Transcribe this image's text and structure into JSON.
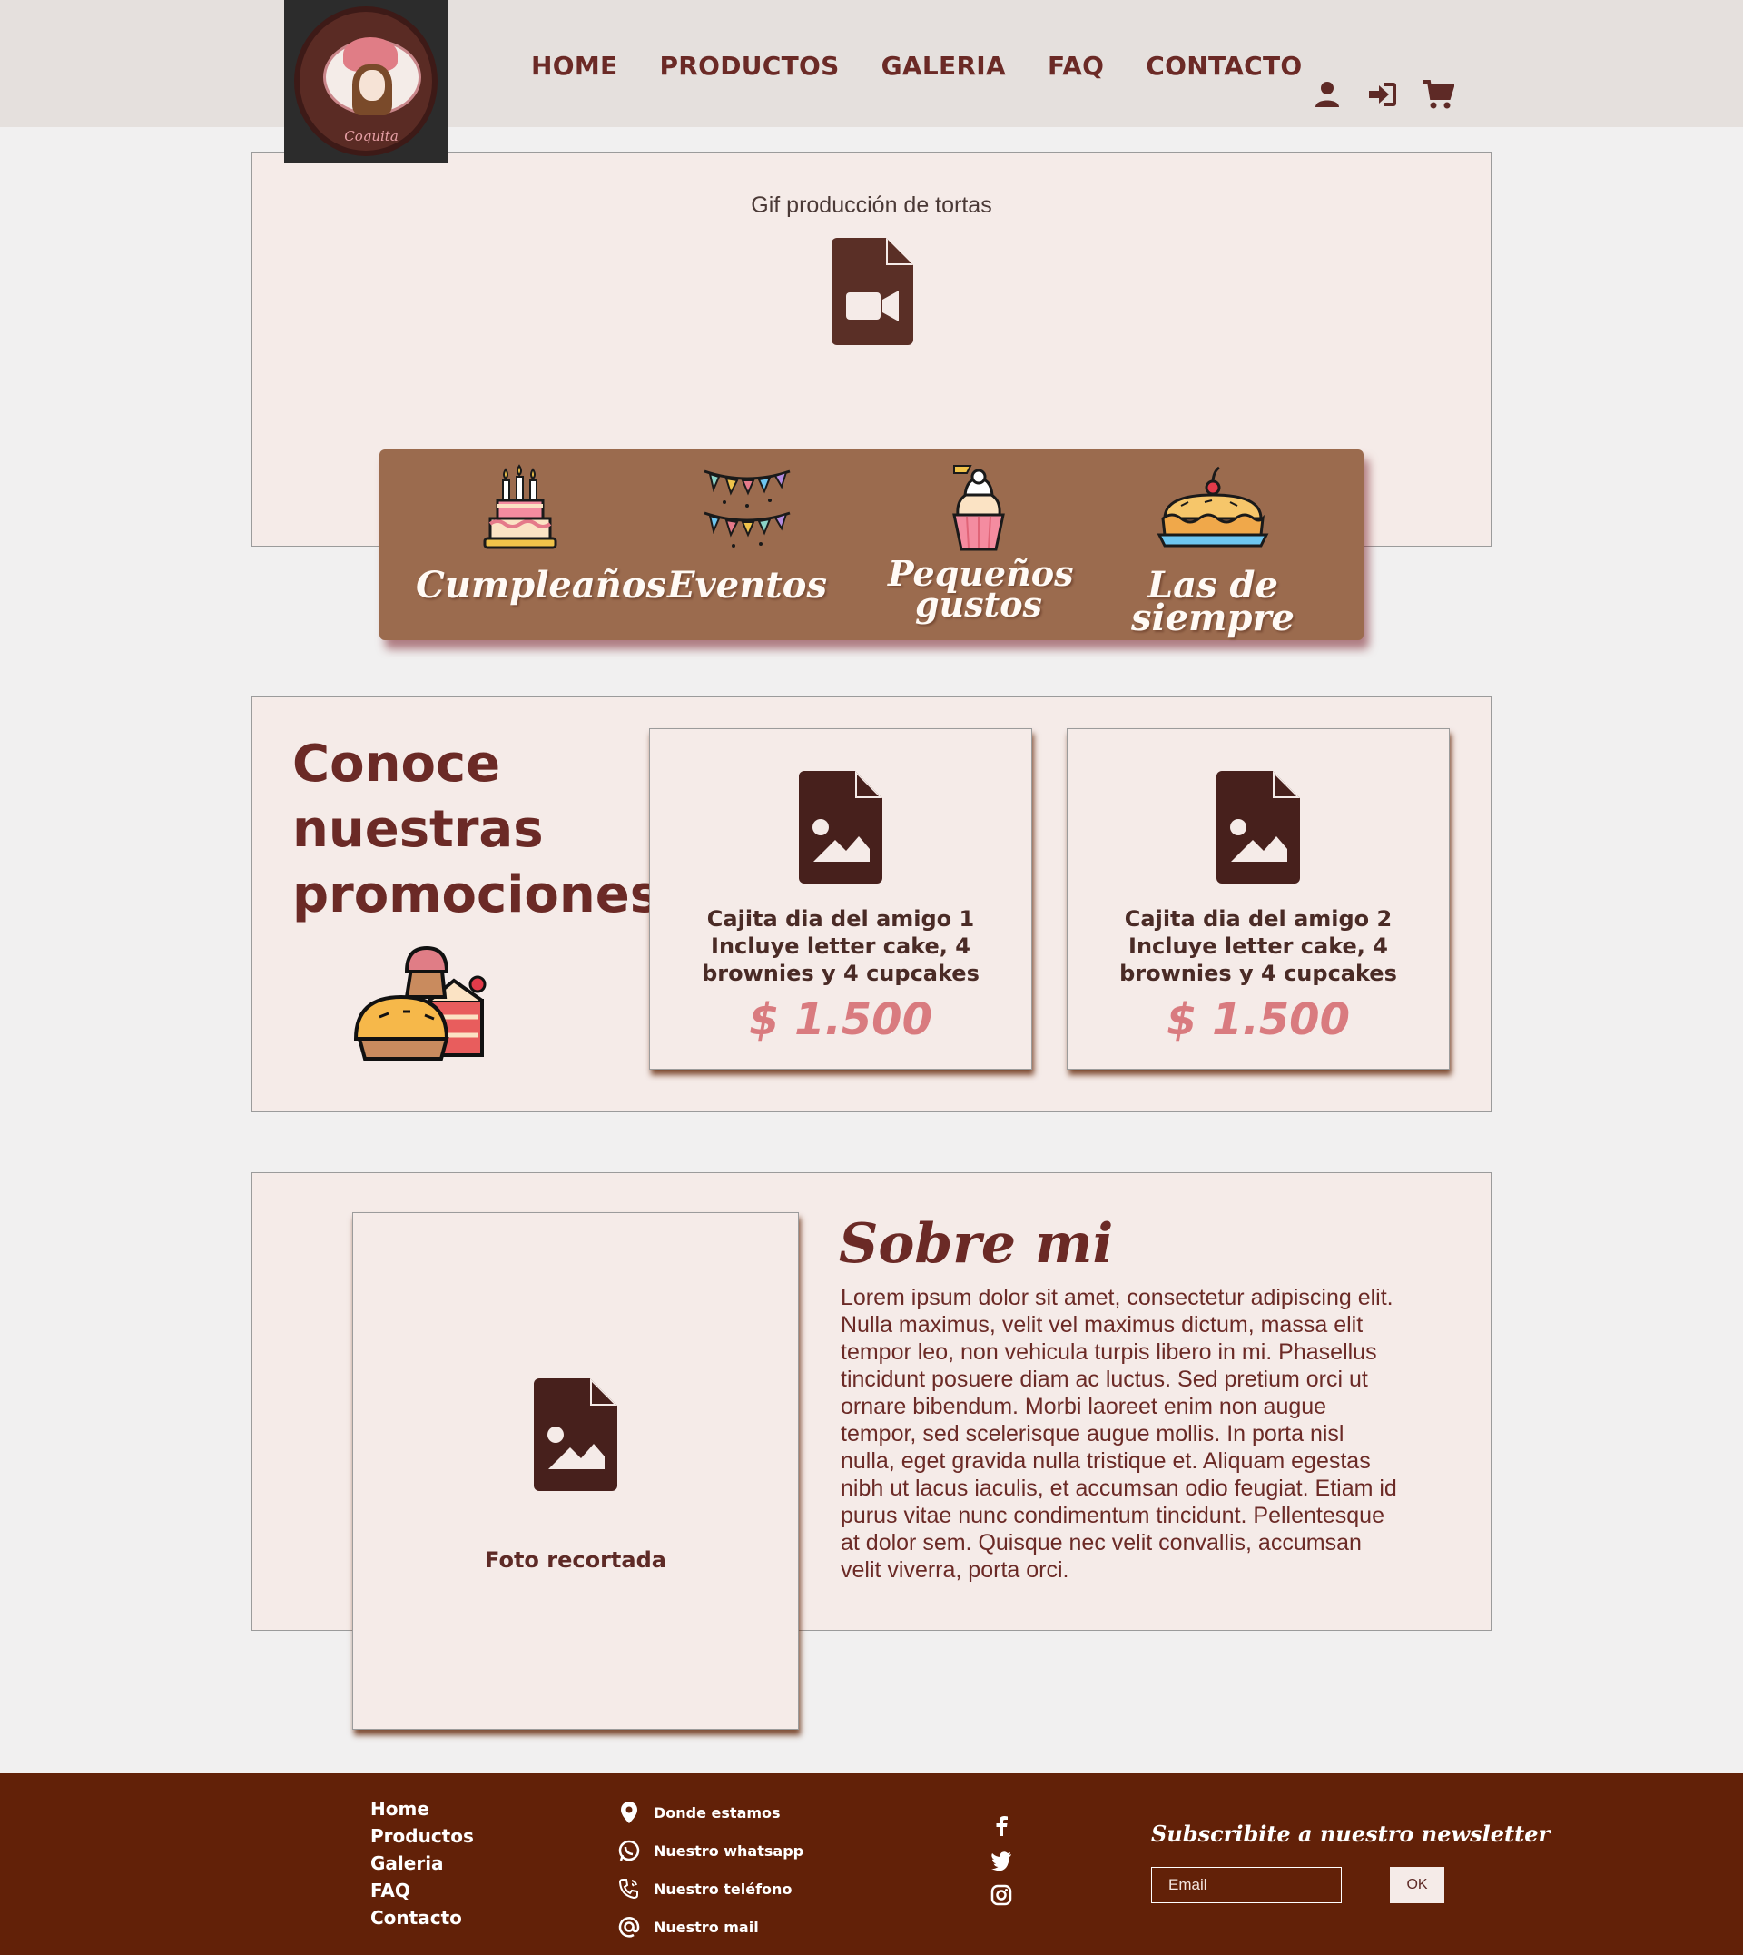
{
  "brand": {
    "logo_text": "Coquita"
  },
  "nav": {
    "items": [
      "HOME",
      "PRODUCTOS",
      "GALERIA",
      "FAQ",
      "CONTACTO"
    ]
  },
  "hero": {
    "caption": "Gif producción de tortas"
  },
  "categories": [
    {
      "label": "Cumpleaños",
      "icon": "birthday-cake-icon"
    },
    {
      "label": "Eventos",
      "icon": "bunting-icon"
    },
    {
      "label": "Pequeños gustos",
      "icon": "cupcake-icon"
    },
    {
      "label": "Las de siempre",
      "icon": "pie-icon"
    }
  ],
  "promos": {
    "title": "Conoce nuestras promociones",
    "cards": [
      {
        "desc": "Cajita dia del amigo 1 Incluye letter cake, 4 brownies y 4 cupcakes",
        "price": "$ 1.500"
      },
      {
        "desc": "Cajita dia del amigo 2 Incluye letter cake, 4 brownies y 4 cupcakes",
        "price": "$ 1.500"
      }
    ]
  },
  "about": {
    "photo_caption": "Foto recortada",
    "title": "Sobre mi",
    "text": "Lorem ipsum dolor sit amet, consectetur adipiscing elit. Nulla maximus, velit vel maximus dictum, massa elit tempor leo, non vehicula turpis libero in mi. Phasellus tincidunt posuere diam ac luctus. Sed pretium orci ut ornare bibendum. Morbi laoreet enim non augue tempor, sed scelerisque augue mollis. In porta nisl nulla, eget gravida nulla tristique et. Aliquam egestas nibh ut lacus iaculis, et accumsan odio feugiat. Etiam id purus vitae nunc condimentum tincidunt. Pellentesque at dolor sem. Quisque nec velit convallis, accumsan velit viverra, porta orci."
  },
  "footer": {
    "links": [
      "Home",
      "Productos",
      "Galeria",
      "FAQ",
      "Contacto"
    ],
    "contact": [
      "Donde estamos",
      "Nuestro whatsapp",
      "Nuestro teléfono",
      "Nuestro mail"
    ],
    "newsletter_title": "Subscribite a nuestro newsletter",
    "email_placeholder": "Email",
    "ok_label": "OK"
  },
  "colors": {
    "primary": "#6b2a26",
    "card_bg": "#f5ebe8",
    "category_bar": "#9b6b4e",
    "price": "#d97b7f",
    "footer": "#622108"
  }
}
